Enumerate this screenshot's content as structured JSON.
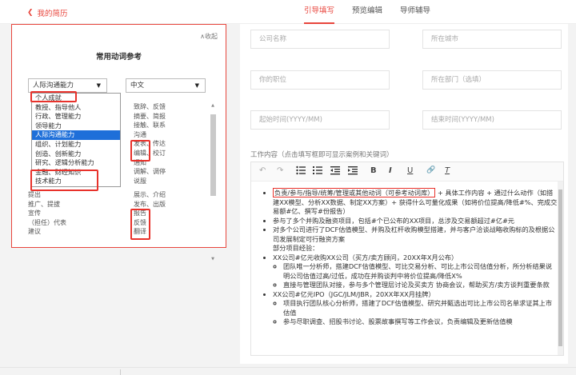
{
  "nav": {
    "back_label": "我的简历"
  },
  "tabs": [
    {
      "label": "引导填写"
    },
    {
      "label": "预览编辑"
    },
    {
      "label": "导师辅导"
    }
  ],
  "panel": {
    "collapse_label": "∧收起",
    "title": "常用动词参考",
    "category_select": "人际沟通能力",
    "language_select": "中文",
    "dropdown_items": [
      "个人成就",
      "教授、指导他人",
      "行政、管理能力",
      "领导能力",
      "人际沟通能力",
      "组织、计划能力",
      "创造、创新能力",
      "研究、逻辑分析能力",
      "金融、财经知识",
      "技术能力"
    ],
    "words_a": [
      "致辞、反馈",
      "摘要、简报",
      "接触、联系",
      "沟通",
      "发表、传达",
      "编辑、校订",
      "通知",
      "调解、调停",
      "说服",
      "展示、介绍",
      "发布、出版",
      "报告",
      "反馈",
      "翻译"
    ],
    "words_b": [
      "提出",
      "推广、提拔",
      "宣传",
      "（担任）代表",
      "建议"
    ]
  },
  "form": {
    "company_placeholder": "公司名称",
    "city_placeholder": "所在城市",
    "position_placeholder": "你的职位",
    "dept_placeholder": "所在部门（选填）",
    "start_placeholder": "起始时间(YYYY/MM)",
    "end_placeholder": "结束时间(YYYY/MM)",
    "work_label": "工作内容（点击填写框即可显示案例和关键词）"
  },
  "toolbar": {
    "undo": "↶",
    "redo": "↷",
    "bold": "B",
    "italic": "I",
    "underline": "U",
    "link": "🔗",
    "clear": "T"
  },
  "editor": {
    "b1_hl": "负责/参与/指导/统筹/管理或其他动词（可参考动词库）",
    "b1_rest": " + 具体工作内容 + 通过什么动作（如搭建XX模型、分析XX数据、制定XX方案）+ 获得什么可量化成果（如将价位提高/降低#%、完成交易额#亿、撰写#份报告）",
    "b2": "参与了多个并购及融资项目，包括#个已公布的XX项目，总涉及交易额超过#亿#元",
    "b3": "对多个公司进行了DCF估值模型、并购及杠杆收购模型搭建，并与客户洽谈战略收购标的及根据公司发展制定可行融资方案",
    "section": "部分项目经验：",
    "p1": "XX公司#亿元收购XX公司（买方/卖方顾问，20XX年X月公布）",
    "p1_s1": "团队唯一分析师，搭建DCF估值模型、可比交易分析、可比上市公司估值分析，所分析结果说明公司估值过高/过低，成功在并购谈判中将价位提高/降低X%",
    "p1_s2": "直接与管理团队对接，参与多个管理层讨论及买卖方 协商会议，帮助买方/卖方谈判重要条款",
    "p2": "XX公司#亿元IPO（JGC/JLM/JBR，20XX年XX月挂牌）",
    "p2_s1": "项目执行团队核心分析师，搭建了DCF估值模型、研究并甄选出可比上市公司名单求证其上市估值",
    "p2_s2": "参与尽职调查、招股书讨论、股票故事撰写等工作会议，负责编辑及更新估值模"
  }
}
